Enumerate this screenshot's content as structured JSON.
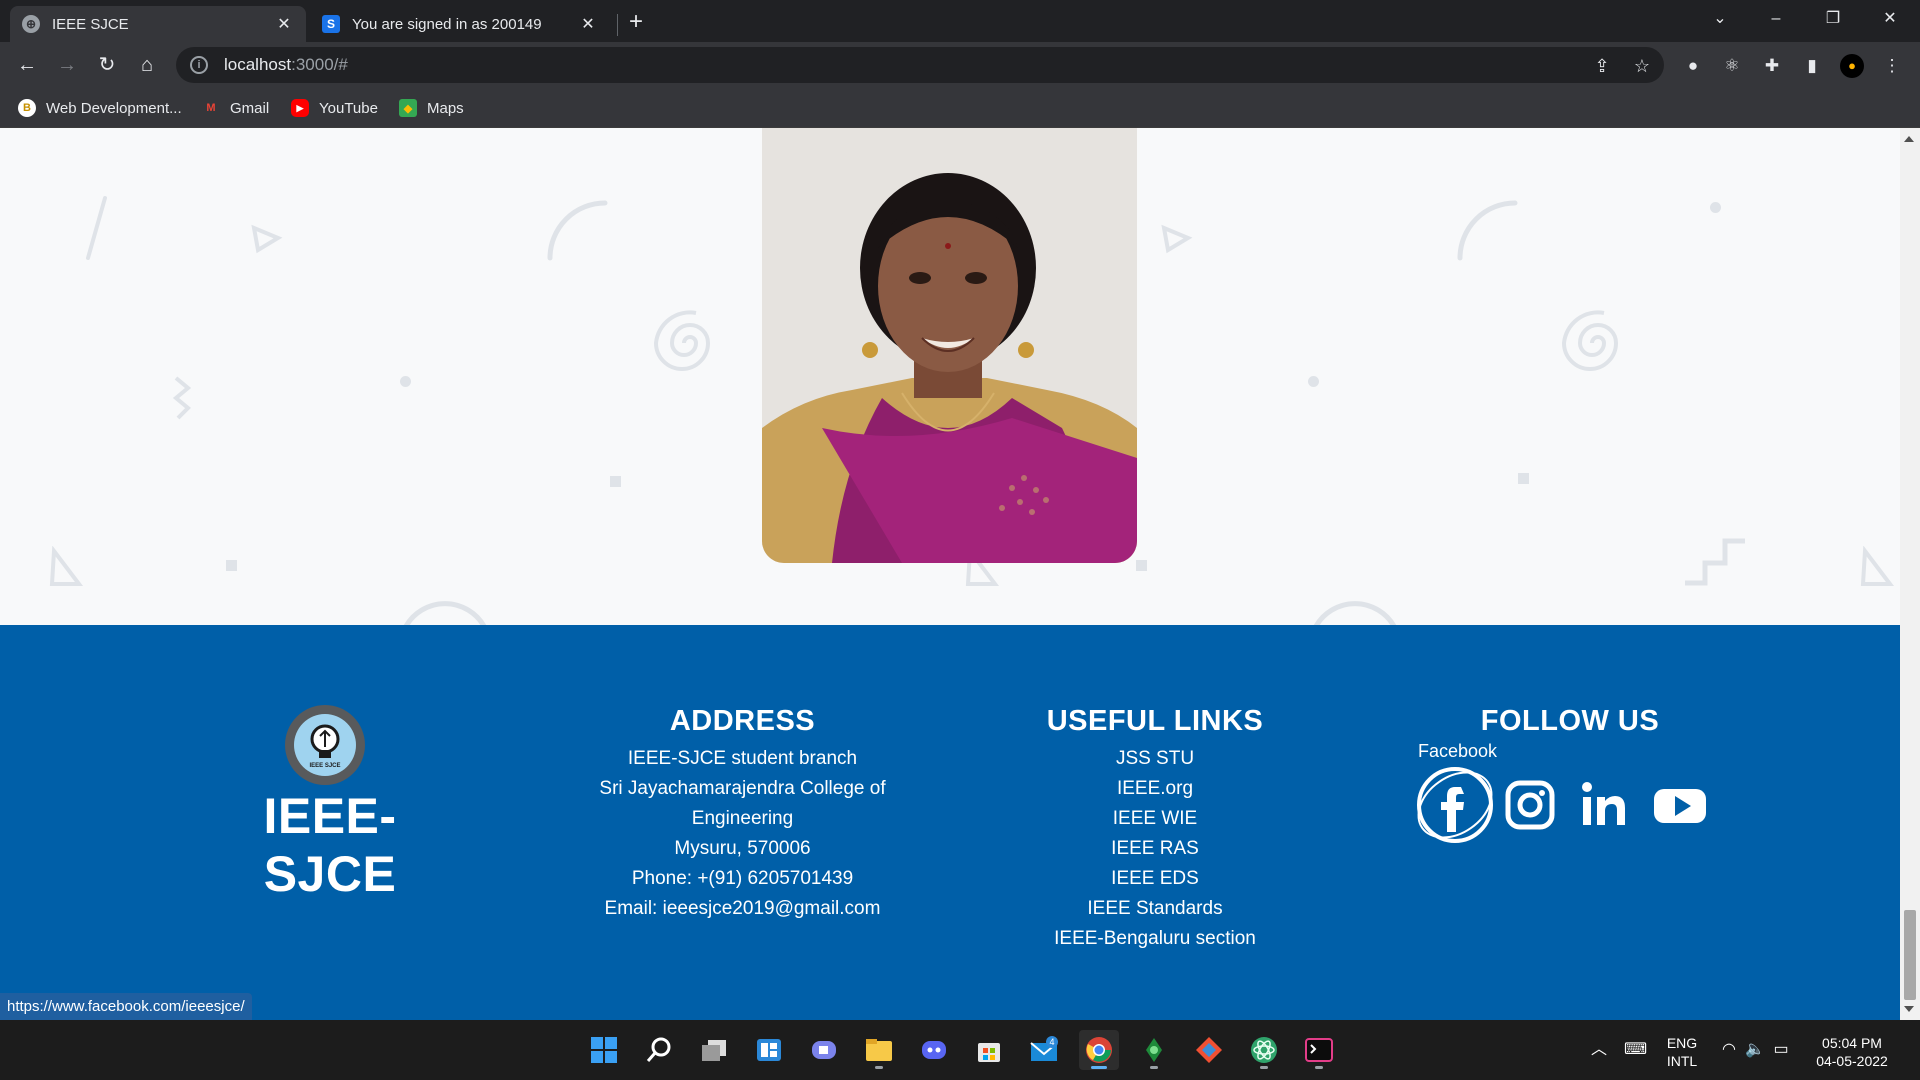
{
  "browser": {
    "tabs": [
      {
        "title": "IEEE SJCE",
        "active": true,
        "favicon": "globe-icon"
      },
      {
        "title": "You are signed in as 200149",
        "active": false,
        "favicon": "s-logo-icon"
      }
    ],
    "address_bar": {
      "host": "localhost",
      "rest": ":3000/#"
    },
    "bookmarks": [
      {
        "label": "Web Development...",
        "icon": "bookmark-favicon"
      },
      {
        "label": "Gmail",
        "icon": "gmail-icon"
      },
      {
        "label": "YouTube",
        "icon": "youtube-icon"
      },
      {
        "label": "Maps",
        "icon": "maps-icon"
      }
    ]
  },
  "footer": {
    "brand": {
      "name": "IEEE-SJCE",
      "logo_text": "IEEE SJCE"
    },
    "address": {
      "heading": "ADDRESS",
      "lines": [
        "IEEE-SJCE student branch",
        "Sri Jayachamarajendra College of",
        "Engineering",
        "Mysuru, 570006",
        "Phone: +(91) 6205701439",
        "Email: ieeesjce2019@gmail.com"
      ]
    },
    "useful_links": {
      "heading": "USEFUL LINKS",
      "links": [
        "JSS STU",
        "IEEE.org",
        "IEEE WIE",
        "IEEE RAS",
        "IEEE EDS",
        "IEEE Standards",
        "IEEE-Bengaluru section"
      ]
    },
    "follow_us": {
      "heading": "FOLLOW US",
      "hover_tooltip": "Facebook",
      "icons": [
        "facebook-icon",
        "instagram-icon",
        "linkedin-icon",
        "youtube-icon"
      ]
    }
  },
  "status_url": "https://www.facebook.com/ieeesjce/",
  "colors": {
    "footer_bg": "#005fa8",
    "hero_bg": "#f8f9fa",
    "chrome_dark": "#202124",
    "chrome_toolbar": "#35363a"
  },
  "taskbar": {
    "apps": [
      "windows-start-icon",
      "search-icon",
      "task-view-icon",
      "widgets-icon",
      "teams-chat-icon",
      "file-explorer-icon",
      "discord-icon",
      "microsoft-store-icon",
      "mail-icon",
      "chrome-icon",
      "robo-icon",
      "git-icon",
      "atom-icon",
      "terminal-icon"
    ],
    "mail_badge": "4",
    "tray": {
      "lang_line1": "ENG",
      "lang_line2": "INTL",
      "time": "05:04 PM",
      "date": "04-05-2022"
    }
  }
}
